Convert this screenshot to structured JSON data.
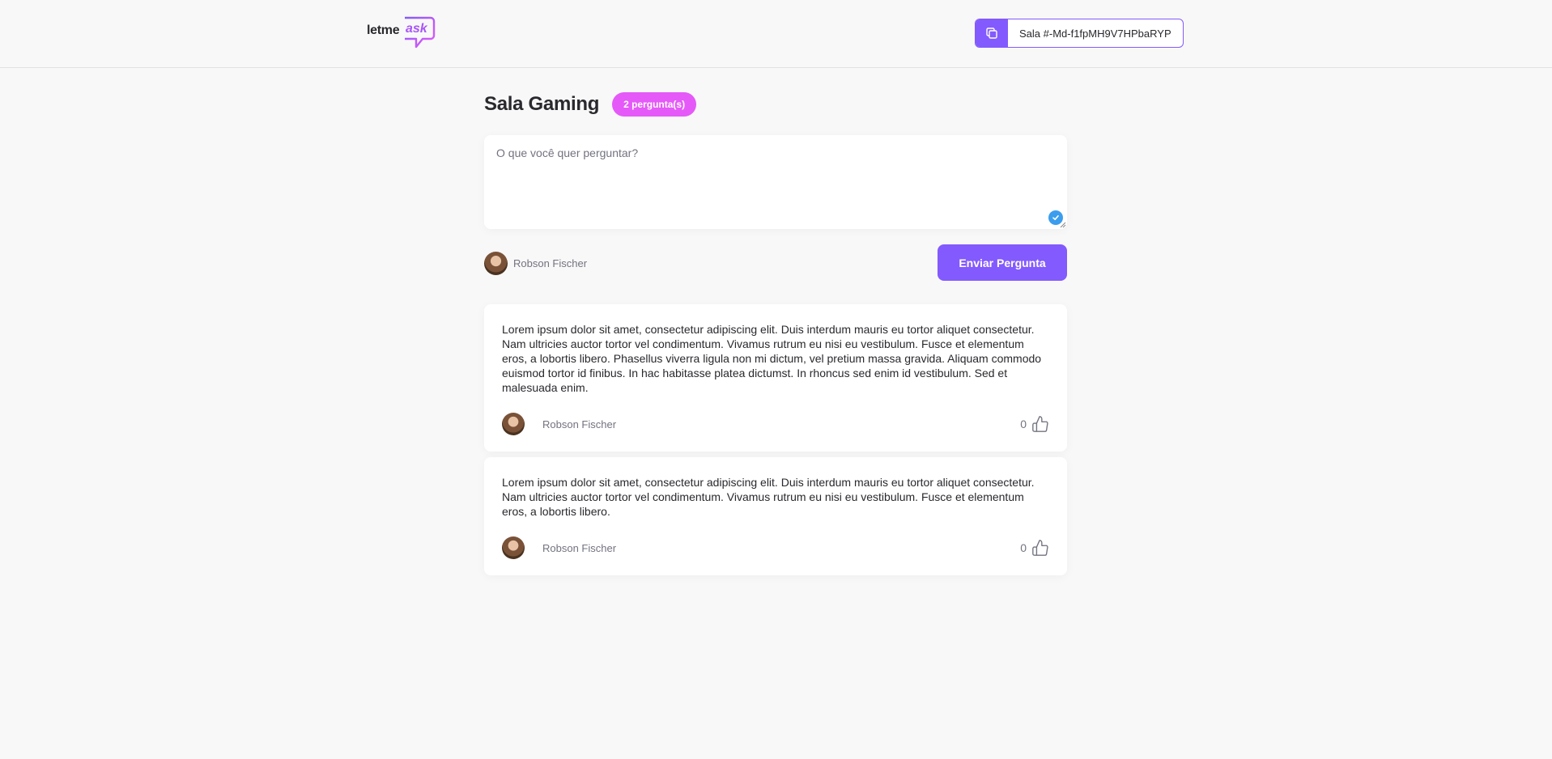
{
  "header": {
    "logo_primary": "letme",
    "logo_accent": "ask",
    "room_code_label": "Sala #-Md-f1fpMH9V7HPbaRYP"
  },
  "room": {
    "title": "Sala Gaming",
    "question_count_badge": "2 pergunta(s)"
  },
  "form": {
    "placeholder": "O que você quer perguntar?",
    "value": "",
    "user_name": "Robson Fischer",
    "send_label": "Enviar Pergunta"
  },
  "questions": [
    {
      "content": "Lorem ipsum dolor sit amet, consectetur adipiscing elit. Duis interdum mauris eu tortor aliquet consectetur. Nam ultricies auctor tortor vel condimentum. Vivamus rutrum eu nisi eu vestibulum. Fusce et elementum eros, a lobortis libero. Phasellus viverra ligula non mi dictum, vel pretium massa gravida. Aliquam commodo euismod tortor id finibus. In hac habitasse platea dictumst. In rhoncus sed enim id vestibulum. Sed et malesuada enim.",
      "author": "Robson Fischer",
      "likes": "0"
    },
    {
      "content": "Lorem ipsum dolor sit amet, consectetur adipiscing elit. Duis interdum mauris eu tortor aliquet consectetur. Nam ultricies auctor tortor vel condimentum. Vivamus rutrum eu nisi eu vestibulum. Fusce et elementum eros, a lobortis libero.",
      "author": "Robson Fischer",
      "likes": "0"
    }
  ],
  "colors": {
    "primary": "#835afd",
    "badge": "#e559f9",
    "background": "#f8f8f8",
    "text": "#29292e",
    "muted": "#737380"
  },
  "icons": {
    "copy": "copy-icon",
    "like": "thumbs-up-icon",
    "check": "check-circle-icon"
  }
}
